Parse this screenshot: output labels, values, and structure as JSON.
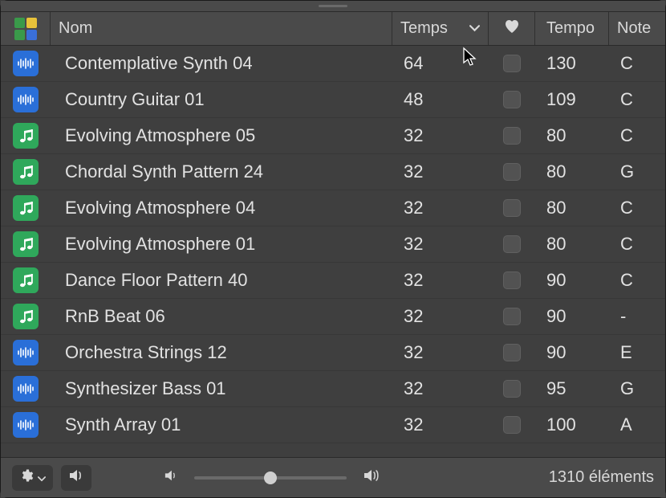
{
  "columns": {
    "name": "Nom",
    "beats": "Temps",
    "tempo": "Tempo",
    "key": "Note"
  },
  "rows": [
    {
      "type": "audio",
      "name": "Contemplative Synth 04",
      "beats": "64",
      "tempo": "130",
      "key": "C"
    },
    {
      "type": "audio",
      "name": "Country Guitar 01",
      "beats": "48",
      "tempo": "109",
      "key": "C"
    },
    {
      "type": "midi",
      "name": "Evolving Atmosphere 05",
      "beats": "32",
      "tempo": "80",
      "key": "C"
    },
    {
      "type": "midi",
      "name": "Chordal Synth Pattern 24",
      "beats": "32",
      "tempo": "80",
      "key": "G"
    },
    {
      "type": "midi",
      "name": "Evolving Atmosphere 04",
      "beats": "32",
      "tempo": "80",
      "key": "C"
    },
    {
      "type": "midi",
      "name": "Evolving Atmosphere 01",
      "beats": "32",
      "tempo": "80",
      "key": "C"
    },
    {
      "type": "midi",
      "name": "Dance Floor Pattern 40",
      "beats": "32",
      "tempo": "90",
      "key": "C"
    },
    {
      "type": "midi",
      "name": "RnB Beat 06",
      "beats": "32",
      "tempo": "90",
      "key": "-"
    },
    {
      "type": "audio",
      "name": "Orchestra Strings 12",
      "beats": "32",
      "tempo": "90",
      "key": "E"
    },
    {
      "type": "audio",
      "name": "Synthesizer Bass 01",
      "beats": "32",
      "tempo": "95",
      "key": "G"
    },
    {
      "type": "audio",
      "name": "Synth Array 01",
      "beats": "32",
      "tempo": "100",
      "key": "A"
    }
  ],
  "footer": {
    "count_text": "1310 éléments"
  },
  "icons": {
    "audio": "audio-waveform-icon",
    "midi": "music-notes-icon",
    "favorite": "heart-icon",
    "sort": "chevron-down-icon",
    "gear": "gear-icon",
    "speaker": "speaker-icon",
    "vol_low": "volume-low-icon",
    "vol_high": "volume-high-icon"
  },
  "colors": {
    "audio_bg": "#2a6fd8",
    "midi_bg": "#2fa85b",
    "panel_bg": "#3f3f3f",
    "header_bg": "#4a4a4a"
  }
}
